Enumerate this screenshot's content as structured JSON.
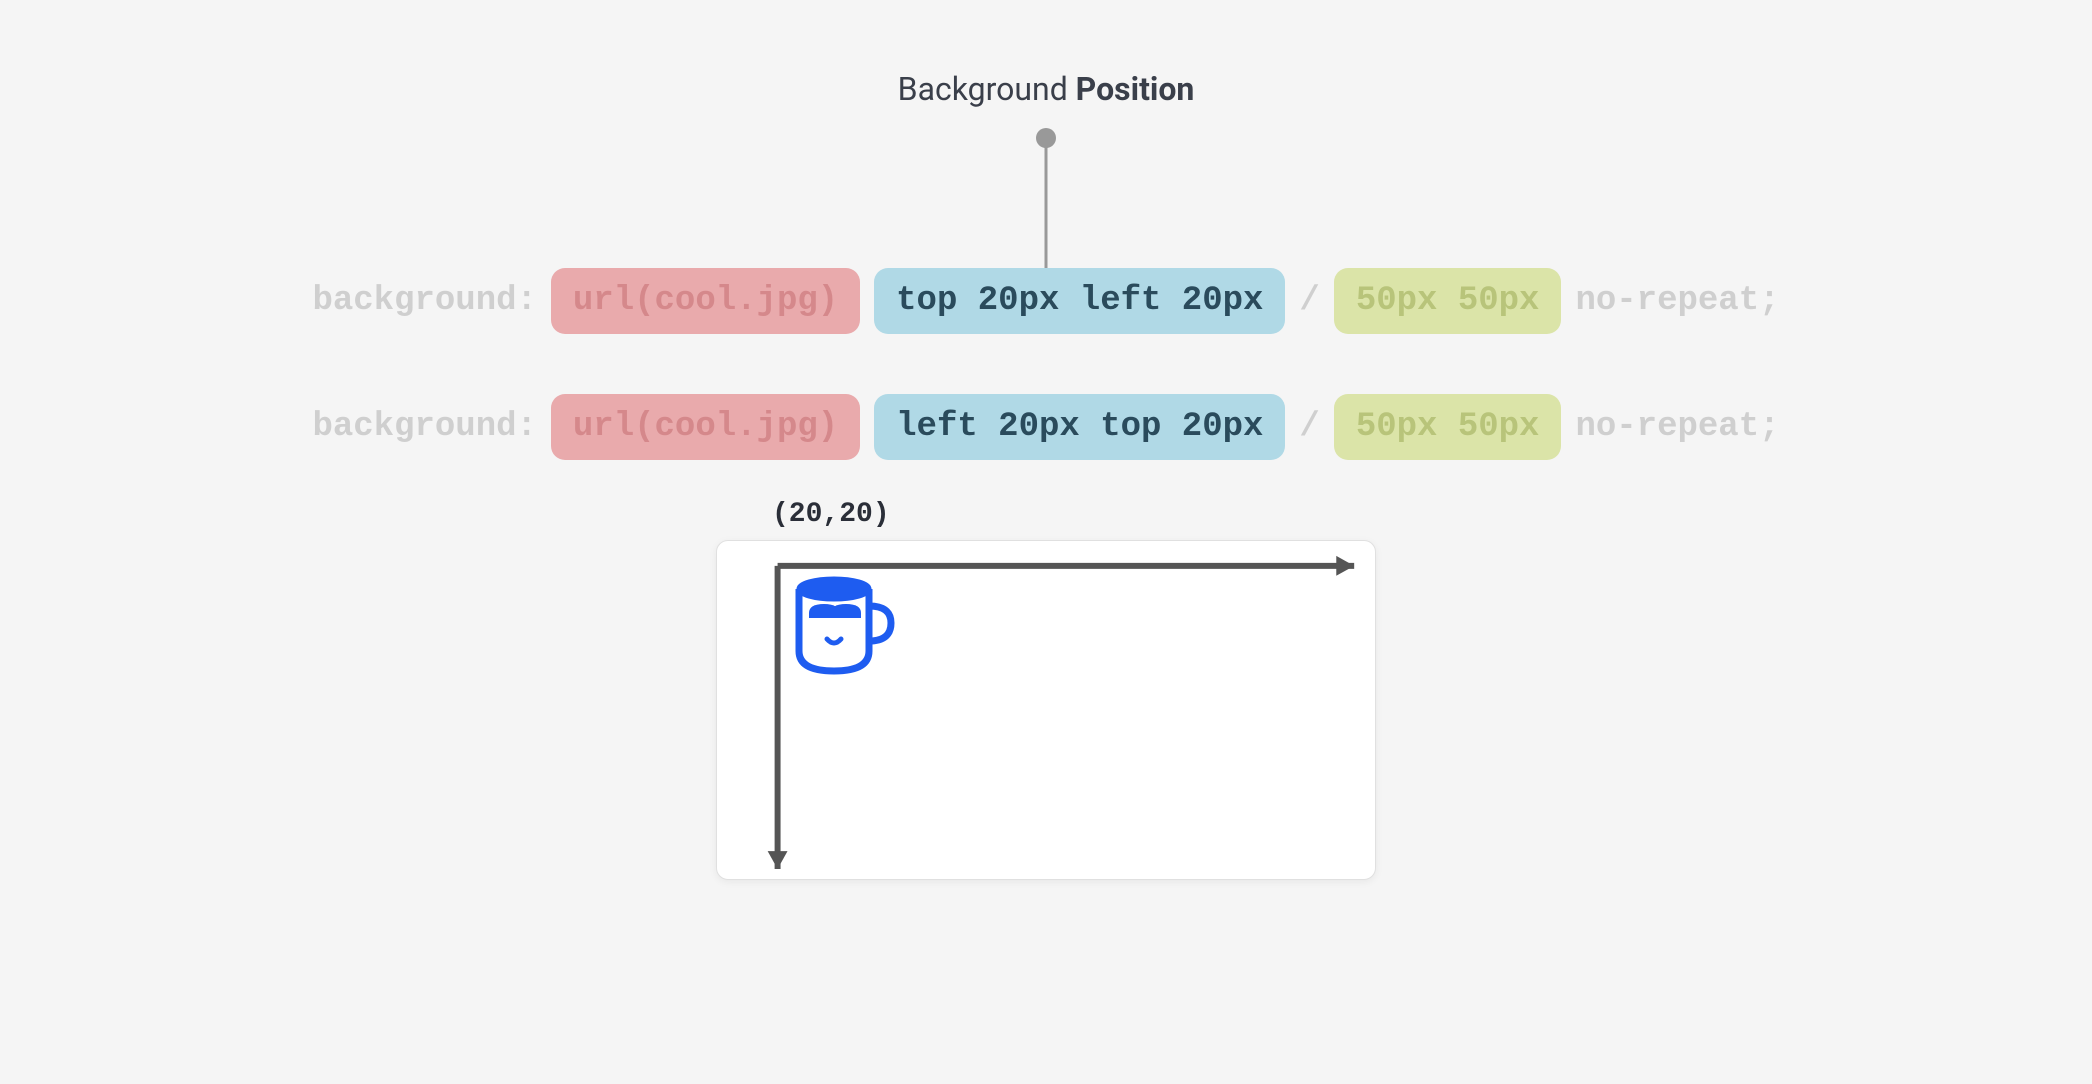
{
  "title": {
    "prefix": "Background ",
    "bold": "Position"
  },
  "code_lines": [
    {
      "property": "background:",
      "url": "url(cool.jpg)",
      "position": "top 20px left 20px",
      "separator": "/",
      "size": "50px 50px",
      "repeat": "no-repeat;"
    },
    {
      "property": "background:",
      "url": "url(cool.jpg)",
      "position": "left 20px top 20px",
      "separator": "/",
      "size": "50px 50px",
      "repeat": "no-repeat;"
    }
  ],
  "visual": {
    "coord_label": "(20,20)"
  },
  "colors": {
    "pill_red_bg": "#e9aaac",
    "pill_blue_bg": "#b0d9e6",
    "pill_green_bg": "#dbe4a8",
    "muted": "#cfcfcf",
    "axis": "#555555",
    "mug": "#1e5cf0"
  }
}
